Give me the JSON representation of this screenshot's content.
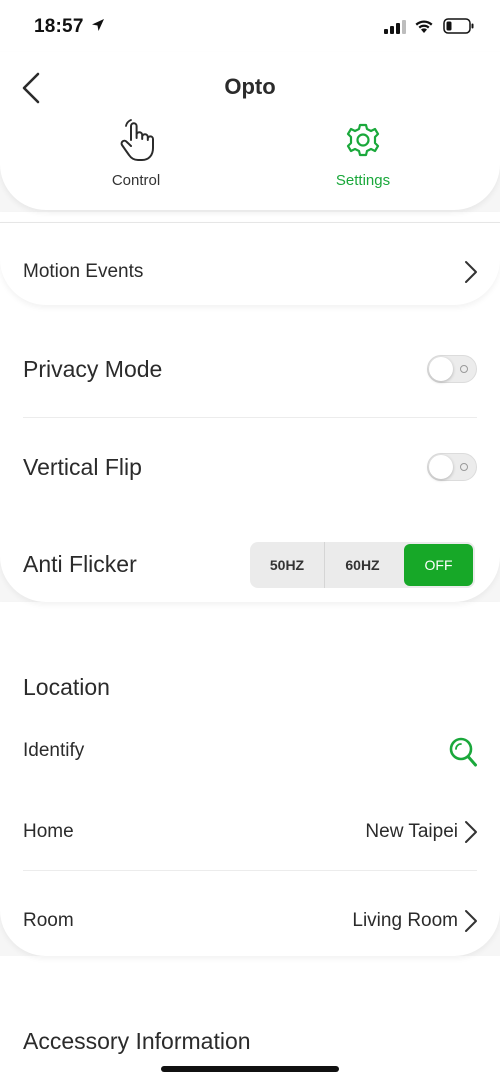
{
  "status_bar": {
    "time": "18:57"
  },
  "header": {
    "title": "Opto"
  },
  "tabs": [
    {
      "label": "Control",
      "icon": "tap-hand-icon",
      "active": false
    },
    {
      "label": "Settings",
      "icon": "gear-icon",
      "active": true
    }
  ],
  "motion_events": {
    "label": "Motion Events"
  },
  "privacy_mode": {
    "label": "Privacy Mode",
    "enabled": false
  },
  "vertical_flip": {
    "label": "Vertical Flip",
    "enabled": false
  },
  "anti_flicker": {
    "label": "Anti Flicker",
    "options": [
      "50HZ",
      "60HZ",
      "OFF"
    ],
    "selected": "OFF"
  },
  "location": {
    "section_title": "Location",
    "identify_label": "Identify",
    "home_label": "Home",
    "home_value": "New Taipei",
    "room_label": "Room",
    "room_value": "Living Room"
  },
  "accessory": {
    "section_title": "Accessory Information"
  },
  "colors": {
    "accent": "#1aa83b",
    "selected_segment": "#17a828"
  }
}
